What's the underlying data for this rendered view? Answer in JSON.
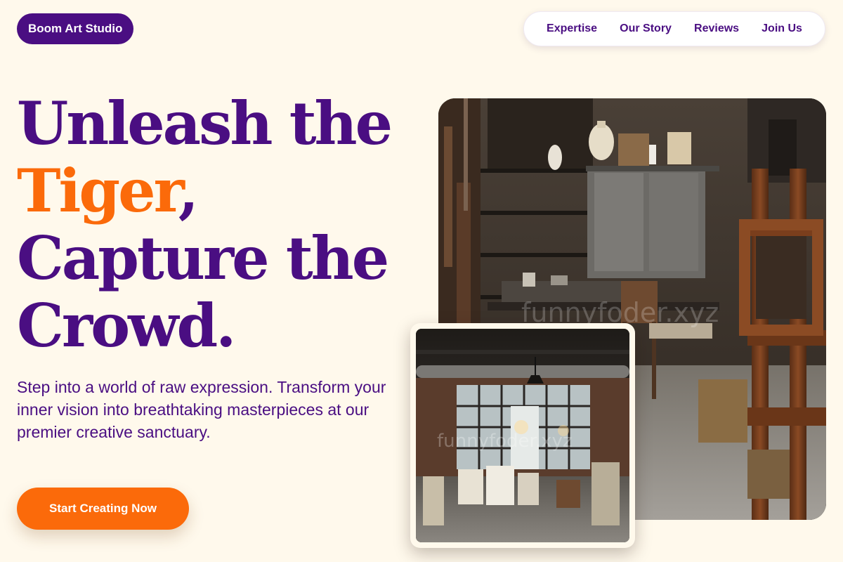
{
  "brand": {
    "name": "Boom Art Studio"
  },
  "nav": {
    "items": [
      {
        "label": "Expertise"
      },
      {
        "label": "Our Story"
      },
      {
        "label": "Reviews"
      },
      {
        "label": "Join Us"
      }
    ]
  },
  "hero": {
    "headline": {
      "line1": "Unleash the",
      "line2_accent": "Tiger",
      "line2_punct": ",",
      "line3": "Capture the",
      "line4": "Crowd."
    },
    "subtext": "Step into a world of raw expression. Transform your inner vision into breathtaking masterpieces at our premier creative sanctuary.",
    "cta_label": "Start Creating Now"
  },
  "images": {
    "main_watermark": "funnyfoder.xyz",
    "secondary_watermark": "funnyfoder.xyz"
  },
  "colors": {
    "background": "#fff9ec",
    "primary": "#4a0e82",
    "accent": "#fb6a0a"
  }
}
